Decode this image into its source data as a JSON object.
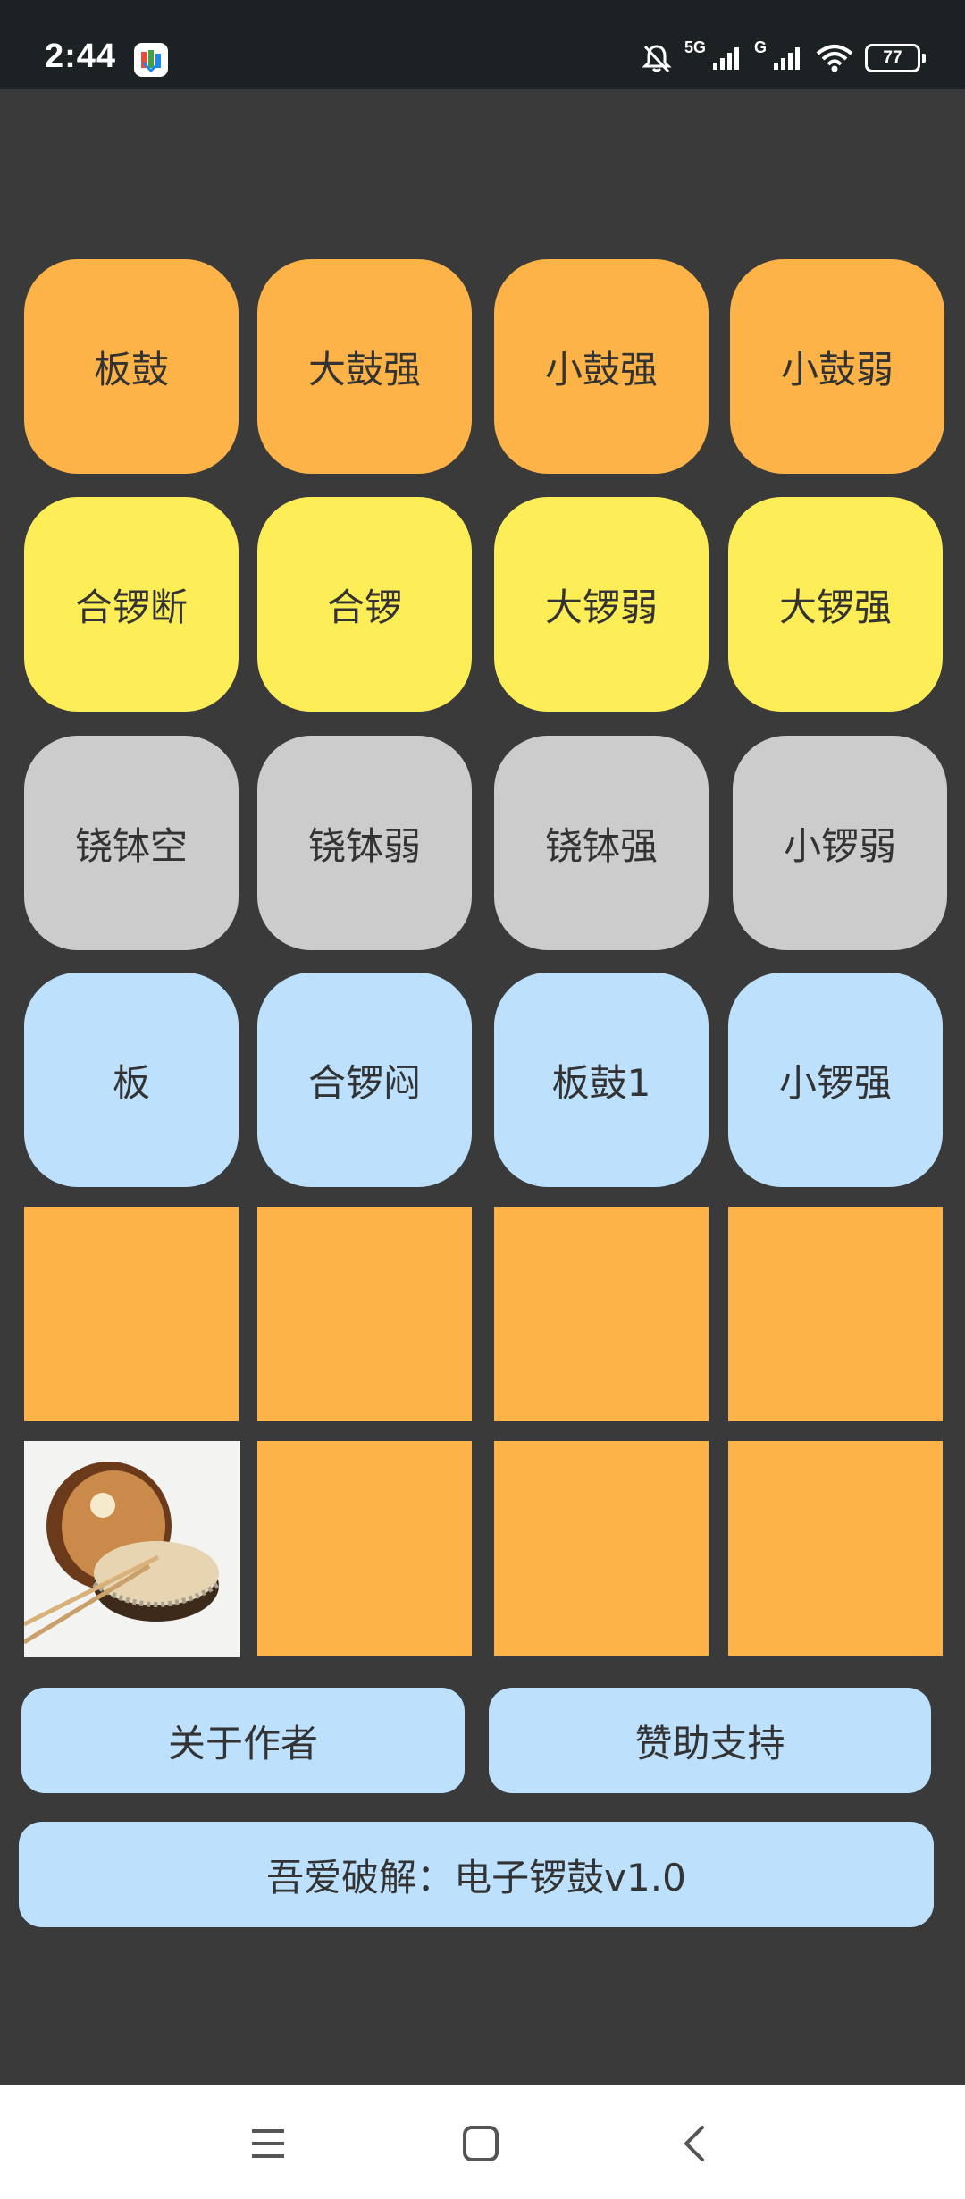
{
  "status_bar": {
    "time": "2:44",
    "network_1": "5G",
    "network_2": "G",
    "battery": "77"
  },
  "pads": {
    "row1": [
      "板鼓",
      "大鼓强",
      "小鼓强",
      "小鼓弱"
    ],
    "row2": [
      "合锣断",
      "合锣",
      "大锣弱",
      "大锣强"
    ],
    "row3": [
      "铙钵空",
      "铙钵弱",
      "铙钵强",
      "小锣弱"
    ],
    "row4": [
      "板",
      "合锣闷",
      "板鼓1",
      "小锣强"
    ]
  },
  "buttons": {
    "about": "关于作者",
    "support": "赞助支持",
    "title_banner": "吾爱破解：电子锣鼓v1.0"
  },
  "colors": {
    "orange": "#fdb347",
    "yellow": "#fdee57",
    "gray": "#cccccc",
    "blue": "#bde0fd",
    "background": "#3a3a3a"
  }
}
